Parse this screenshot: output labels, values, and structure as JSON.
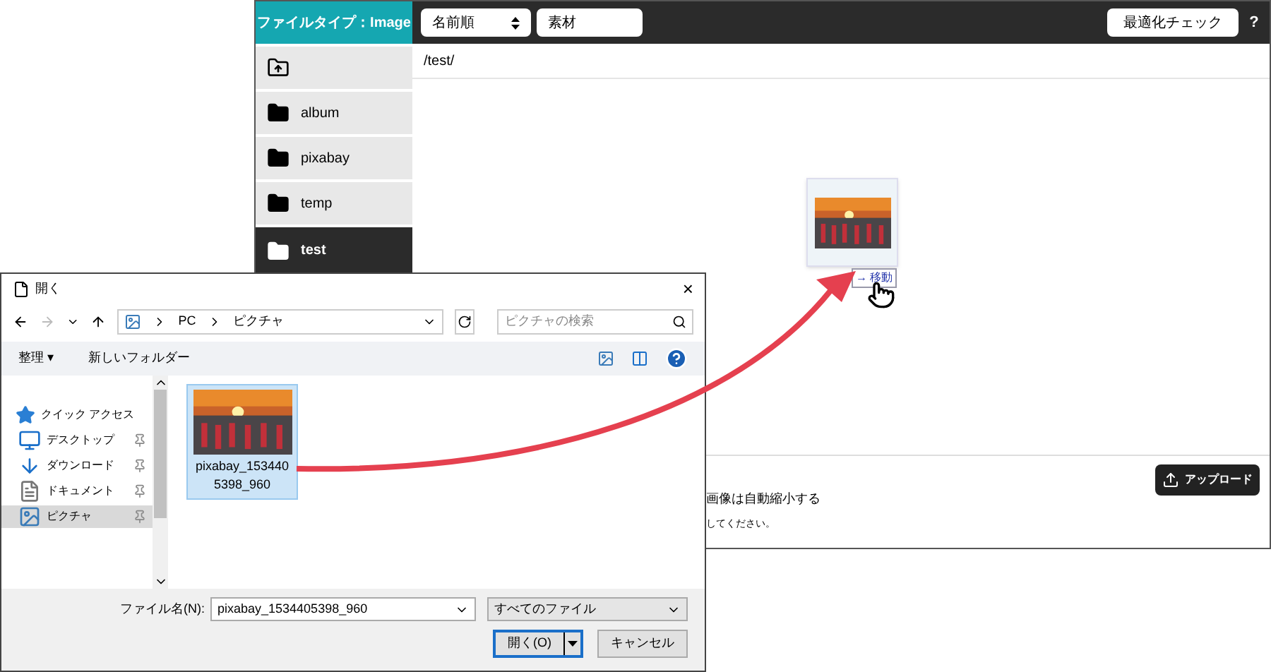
{
  "app": {
    "file_type": "ファイルタイプ：Image",
    "sort": "名前順",
    "search_value": "素材",
    "check_button": "最適化チェック",
    "help": "?",
    "folders": [
      {
        "kind": "up",
        "selected": false
      },
      {
        "kind": "folder",
        "label": "album",
        "selected": false
      },
      {
        "kind": "folder",
        "label": "pixabay",
        "selected": false
      },
      {
        "kind": "folder",
        "label": "temp",
        "selected": false
      },
      {
        "kind": "folder",
        "label": "test",
        "selected": true
      }
    ],
    "path": "/test/",
    "thumbnail": {
      "move_label": "→ 移動"
    },
    "upload_button": "アップロード",
    "note_1": "画像は自動縮小する",
    "note_2": "してください。"
  },
  "dialog": {
    "title": "開く",
    "close": "×",
    "breadcrumb": [
      "PC",
      "ピクチャ"
    ],
    "search_placeholder": "ピクチャの検索",
    "organize": "整理 ▾",
    "new_folder": "新しいフォルダー",
    "nav": [
      {
        "kind": "star",
        "label": "クイック アクセス",
        "selected": false,
        "pinned": false
      },
      {
        "kind": "desktop",
        "label": "デスクトップ",
        "selected": false,
        "pinned": true
      },
      {
        "kind": "download",
        "label": "ダウンロード",
        "selected": false,
        "pinned": true
      },
      {
        "kind": "document",
        "label": "ドキュメント",
        "selected": false,
        "pinned": true
      },
      {
        "kind": "picture",
        "label": "ピクチャ",
        "selected": true,
        "pinned": true
      }
    ],
    "files": [
      {
        "name": "pixabay_1534405398_960",
        "selected": true
      }
    ],
    "filename_label": "ファイル名(N):",
    "filename": "pixabay_1534405398_960",
    "filter": "すべてのファイル",
    "open": "開く(O)",
    "cancel": "キャンセル"
  }
}
